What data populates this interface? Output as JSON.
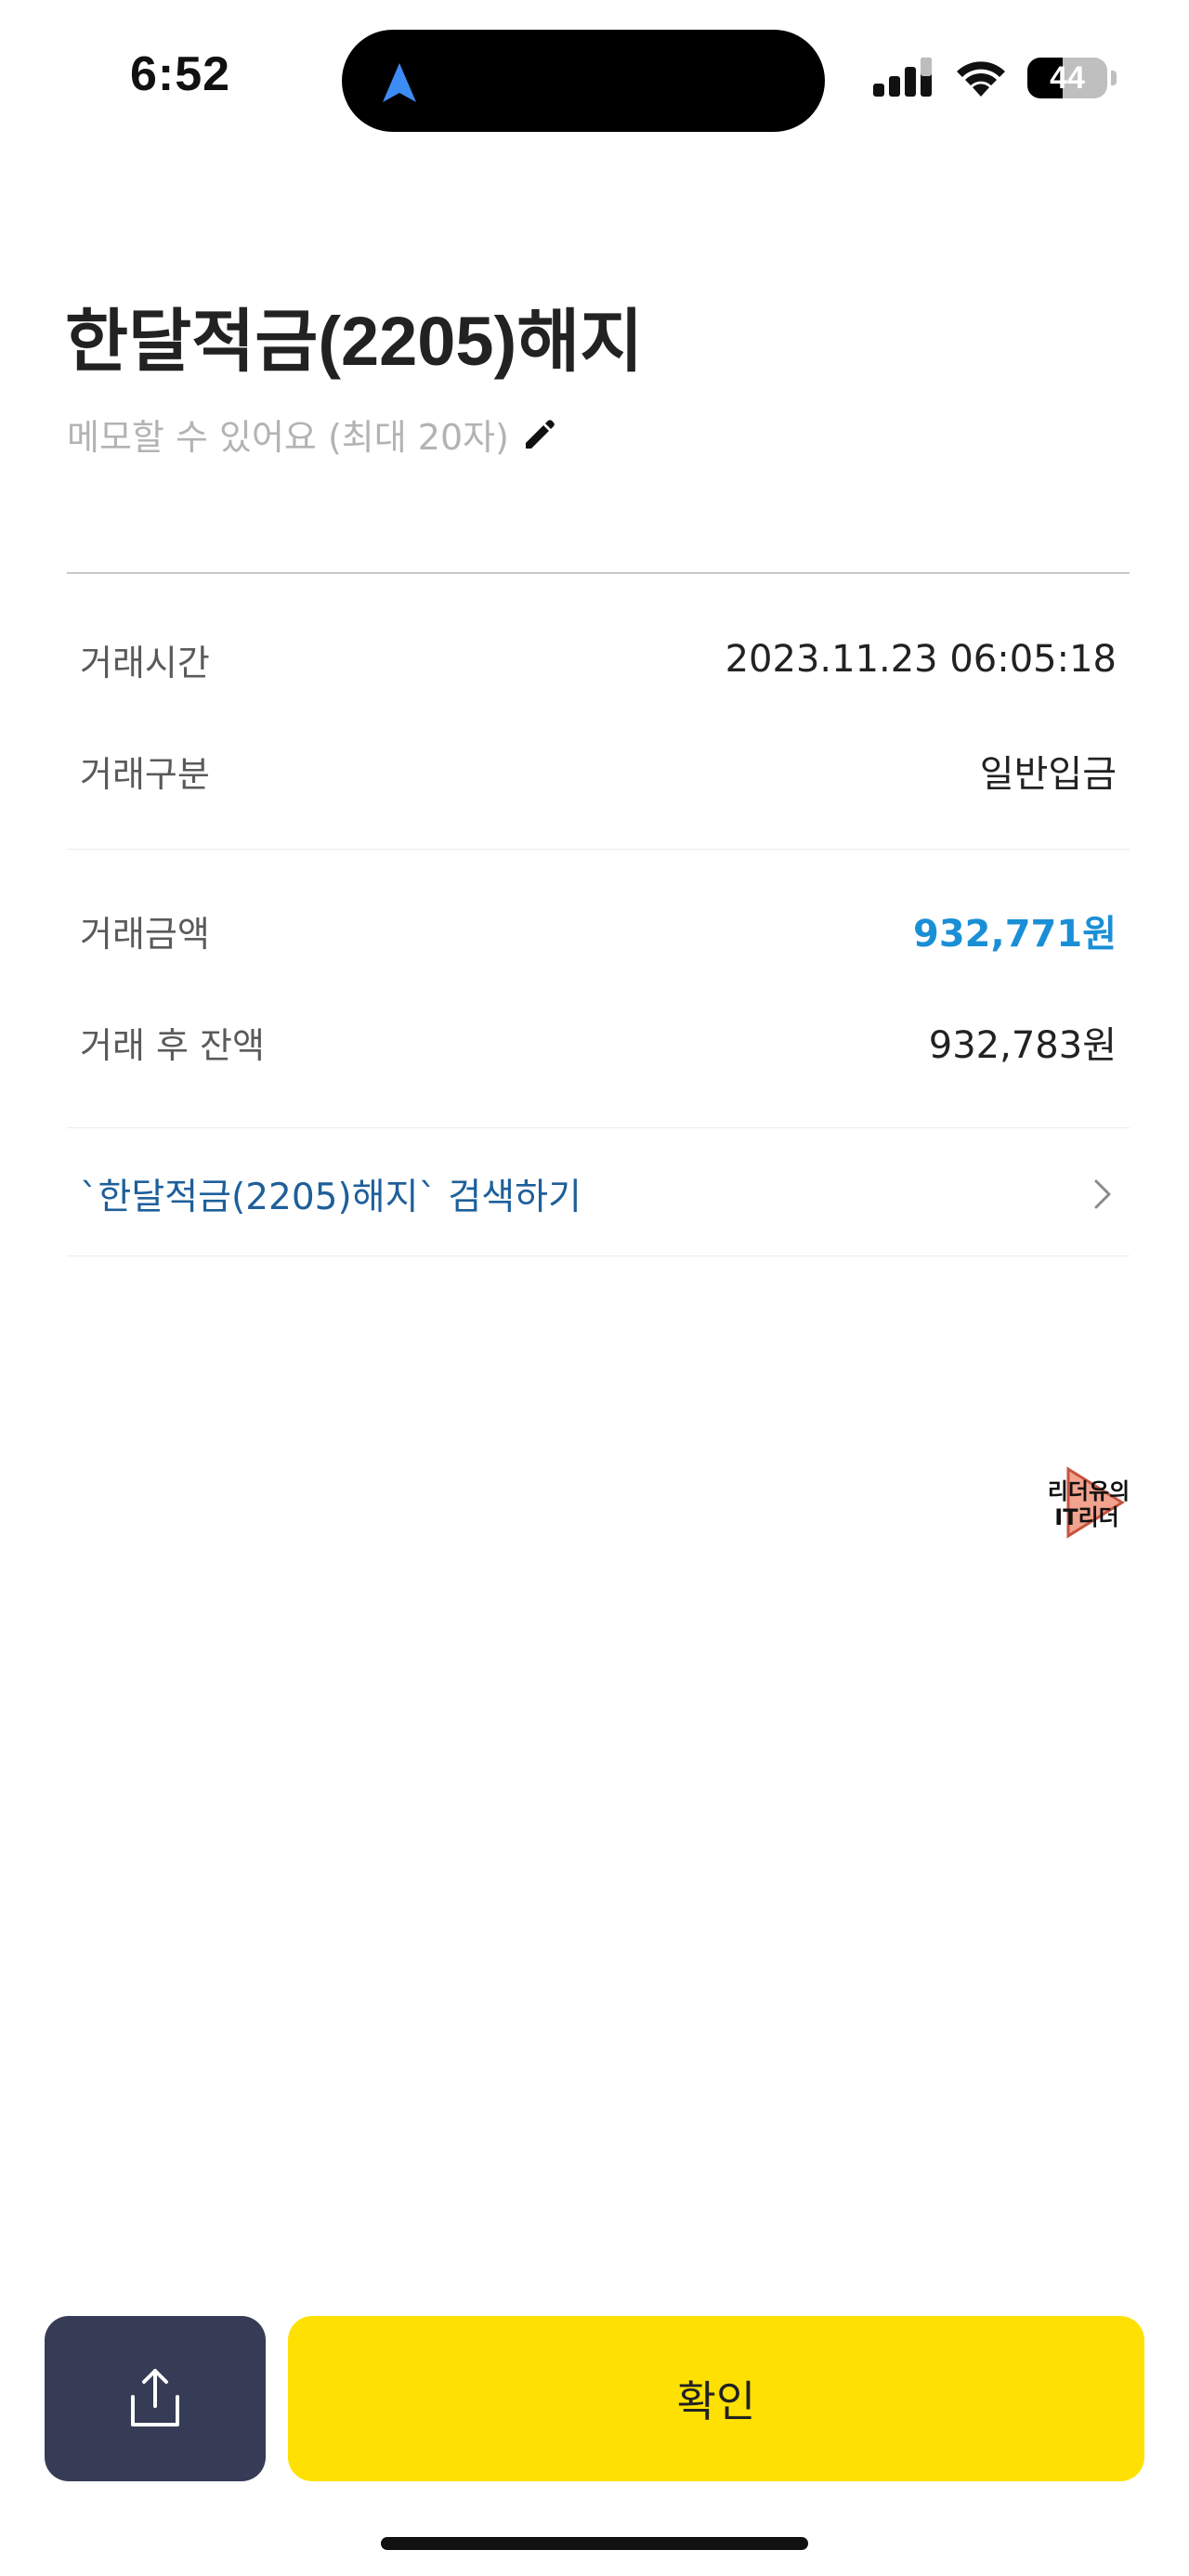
{
  "status_bar": {
    "time": "6:52",
    "battery_level": "44",
    "battery_fraction": 0.44
  },
  "header": {
    "title": "한달적금(2205)해지",
    "memo_placeholder": "메모할 수 있어요 (최대 20자)"
  },
  "details": [
    {
      "label": "거래시간",
      "value": "2023.11.23 06:05:18"
    },
    {
      "label": "거래구분",
      "value": "일반입금"
    },
    {
      "label": "거래금액",
      "value": "932,771원"
    },
    {
      "label": "거래 후 잔액",
      "value": "932,783원"
    }
  ],
  "search_link": {
    "label": "`한달적금(2205)해지` 검색하기"
  },
  "watermark": {
    "text_line1": "리더유의",
    "text_line2": "IT리더"
  },
  "actions": {
    "confirm_label": "확인"
  },
  "icons": {
    "location": "location-arrow-icon",
    "signal": "cellular-signal-icon",
    "wifi": "wifi-icon",
    "edit": "pencil-icon",
    "chevron": "chevron-right-icon",
    "share": "share-icon"
  },
  "colors": {
    "amount_highlight": "#1a8fd6",
    "link": "#1e5f9a",
    "confirm_button": "#fee102",
    "share_button": "#363b56"
  }
}
